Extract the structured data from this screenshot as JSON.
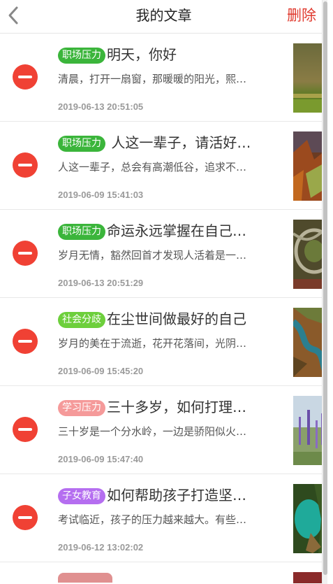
{
  "header": {
    "back_icon": "chevron-left-icon",
    "title": "我的文章",
    "action_label": "删除"
  },
  "colors": {
    "accent": "#e03a2e",
    "remove": "#f04134",
    "tag_green": "#3bb53b",
    "tag_lightgreen": "#6dcf3c",
    "tag_pink": "#f59a9a",
    "tag_purple": "#b56ef0"
  },
  "articles": [
    {
      "tag": "职场压力",
      "tag_color": "#3bb53b",
      "title": "明天，你好",
      "summary": "清晨，打开一扇窗，那暖暖的阳光，熙…",
      "date": "2019-06-13 20:51:05",
      "thumb": "road-thumbnail"
    },
    {
      "tag": "职场压力",
      "tag_color": "#3bb53b",
      "title": " 人这一辈子，请活好…",
      "summary": "人这一辈子，总会有高潮低谷，追求不…",
      "date": "2019-06-09 15:41:03",
      "thumb": "autumn-forest-thumbnail"
    },
    {
      "tag": "职场压力",
      "tag_color": "#3bb53b",
      "title": "命运永远掌握在自己…",
      "summary": "岁月无情，豁然回首才发现人活着是一…",
      "date": "2019-06-13 20:51:29",
      "thumb": "highway-interchange-thumbnail"
    },
    {
      "tag": "社会分歧",
      "tag_color": "#6dcf3c",
      "title": "在尘世间做最好的自己",
      "summary": "岁月的美在于流逝，花开花落间，光阴…",
      "date": "2019-06-09 15:45:20",
      "thumb": "river-aerial-thumbnail"
    },
    {
      "tag": "学习压力",
      "tag_color": "#f59a9a",
      "title": "三十多岁，如何打理…",
      "summary": "三十岁是一个分水岭，一边是骄阳似火…",
      "date": "2019-06-09 15:47:40",
      "thumb": "lavender-field-thumbnail"
    },
    {
      "tag": "子女教育",
      "tag_color": "#b56ef0",
      "title": "如何帮助孩子打造坚…",
      "summary": "考试临近，孩子的压力越来越大。有些…",
      "date": "2019-06-12 13:02:02",
      "thumb": "lake-cliff-thumbnail"
    }
  ]
}
